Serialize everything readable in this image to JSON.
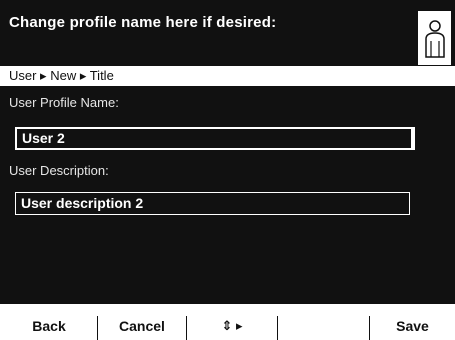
{
  "header": {
    "title": "Change profile name here if desired:",
    "icon": "user-profile-icon"
  },
  "breadcrumb": {
    "text": "User ▸ New ▸ Title"
  },
  "form": {
    "name_label": "User Profile Name:",
    "name_value": "User 2",
    "description_label": "User Description:",
    "description_value": "User description  2"
  },
  "footer": {
    "back_label": "Back",
    "cancel_label": "Cancel",
    "nav_label": "⇕ ▸",
    "empty_label": "",
    "save_label": "Save"
  }
}
